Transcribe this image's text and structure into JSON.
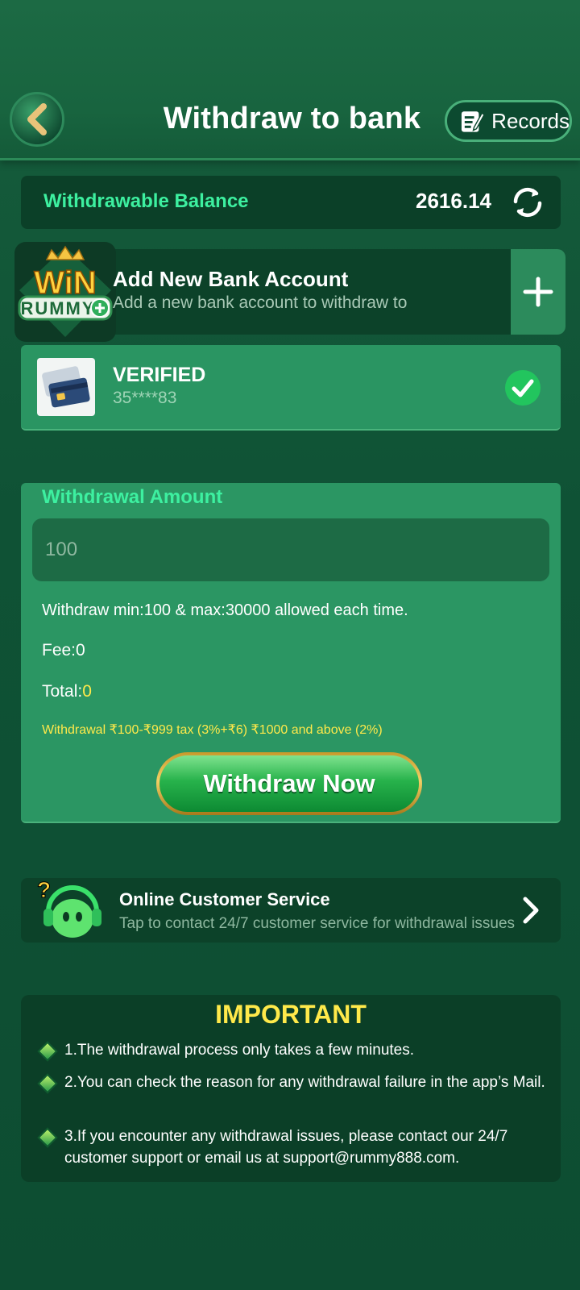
{
  "header": {
    "title": "Withdraw to bank",
    "records_label": "Records"
  },
  "balance": {
    "label": "Withdrawable Balance",
    "value": "2616.14"
  },
  "add_bank": {
    "title": "Add New Bank Account",
    "subtitle": "Add a new bank account to withdraw to",
    "logo_text_top": "WiN",
    "logo_text_bottom": "RUMMY"
  },
  "bank_account": {
    "status": "VERIFIED",
    "number": "35****83"
  },
  "withdrawal": {
    "title": "Withdrawal Amount",
    "placeholder": "100",
    "limits": "Withdraw min:100 & max:30000 allowed each time.",
    "fee": "Fee:0",
    "total_label": "Total:",
    "total_value": "0",
    "tax_note": "Withdrawal ₹100-₹999 tax (3%+₹6) ₹1000 and above (2%)",
    "button_label": "Withdraw Now"
  },
  "customer_service": {
    "title": "Online Customer Service",
    "subtitle": "Tap to contact 24/7 customer service for withdrawal issues"
  },
  "important": {
    "title": "IMPORTANT",
    "items": [
      "1.The withdrawal process only takes a few minutes.",
      "2.You can check the reason for any withdrawal failure in the app’s Mail.",
      "3.If you encounter any withdrawal issues, please contact our 24/7 customer support or email us at support@rummy888.com."
    ]
  },
  "colors": {
    "accent_green": "#3df0a0",
    "highlight_yellow": "#ffe94a",
    "check_green": "#22c55e"
  },
  "icons": {
    "back": "chevron-left-icon",
    "records": "notepad-pencil-icon",
    "refresh": "refresh-icon",
    "add": "plus-icon",
    "card": "credit-card-icon",
    "verified": "check-circle-icon",
    "support": "headset-bot-icon",
    "chevron": "chevron-right-icon"
  }
}
